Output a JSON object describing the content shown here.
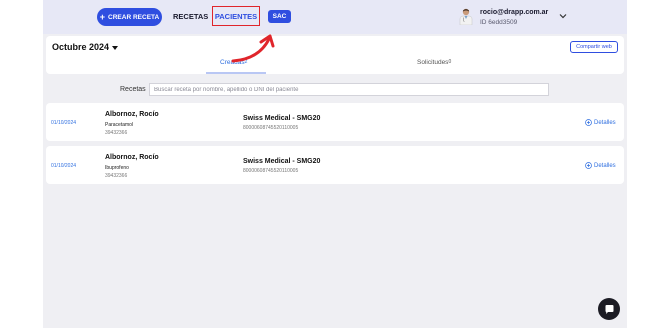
{
  "header": {
    "new_button_label": "CREAR RECETA",
    "nav_recetas": "RECETAS",
    "nav_pacientes": "PACIENTES",
    "sac_label": "SAC",
    "user_email": "rocio@drapp.com.ar",
    "user_id": "ID 6edd3509"
  },
  "toolbar": {
    "month": "Octubre 2024",
    "share_label": "Compartir web",
    "tabs": [
      {
        "label": "Creadas",
        "count": "2"
      },
      {
        "label": "Solicitudes",
        "count": "0"
      }
    ]
  },
  "search": {
    "label": "Recetas",
    "placeholder": "Buscar receta por nombre, apellido o DNI del paciente"
  },
  "prescriptions": [
    {
      "date": "01/10/2024",
      "patient": "Albornoz, Rocío",
      "medication": "Paracetamol",
      "dni": "39432366",
      "insurance": "Swiss Medical - SMG20",
      "credential": "80000608745520110005",
      "details_label": "Detalles"
    },
    {
      "date": "01/10/2024",
      "patient": "Albornoz, Rocío",
      "medication": "Ibuprofeno",
      "dni": "39432366",
      "insurance": "Swiss Medical - SMG20",
      "credential": "80000608745520110005",
      "details_label": "Detalles"
    }
  ],
  "colors": {
    "accent": "#2f4ee0",
    "highlight_box": "#e0252b",
    "annotation_arrow": "#e0252b"
  }
}
